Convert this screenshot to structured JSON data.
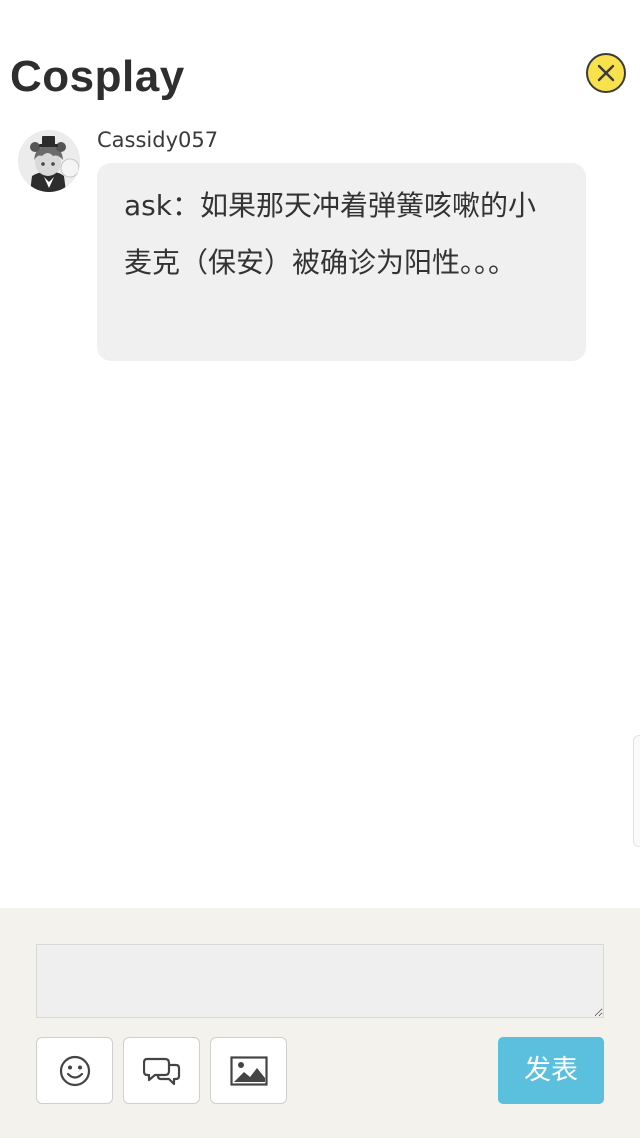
{
  "header": {
    "title": "Cosplay",
    "close_icon": "close-circle-icon",
    "close_color": "#f7e24b"
  },
  "post": {
    "username": "Cassidy057",
    "avatar_icon": "avatar-image",
    "message": "ask：如果那天冲着弹簧咳嗽的小麦克（保安）被确诊为阳性。。。"
  },
  "composer": {
    "input_value": "",
    "input_placeholder": "",
    "tools": [
      {
        "icon": "emoji-icon"
      },
      {
        "icon": "quote-icon"
      },
      {
        "icon": "image-icon"
      }
    ],
    "submit_label": "发表",
    "submit_color": "#5bc0de",
    "background_color": "#f3f2ec"
  }
}
